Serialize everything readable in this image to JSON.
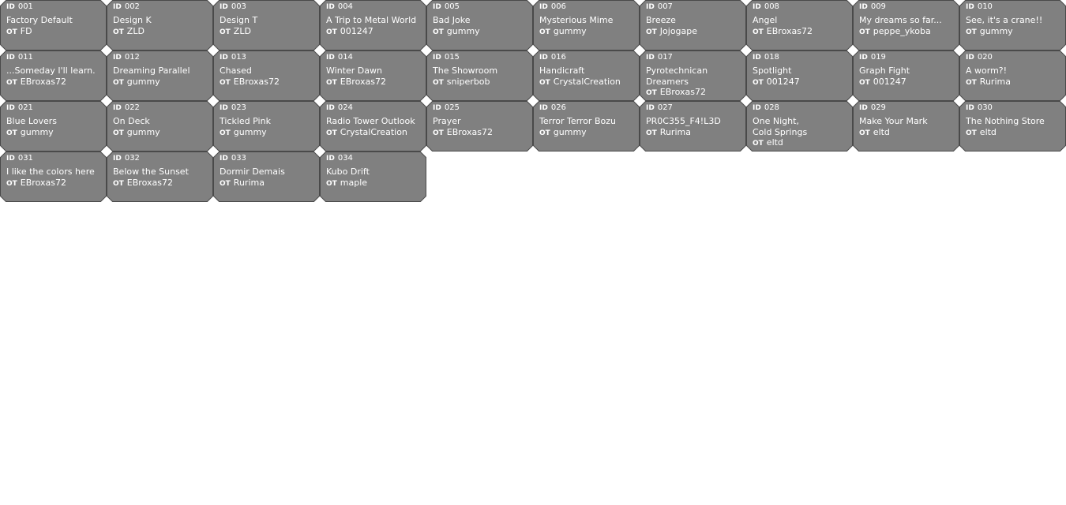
{
  "colors": {
    "tile_fill": "#808080",
    "tile_border": "#4a4a4a",
    "text": "#ffffff",
    "background": "#ffffff"
  },
  "labels": {
    "id_tag": "ID",
    "ot_tag": "OT"
  },
  "tiles": [
    {
      "id": "001",
      "title": "Factory Default",
      "ot": "FD"
    },
    {
      "id": "002",
      "title": "Design K",
      "ot": "ZLD"
    },
    {
      "id": "003",
      "title": "Design T",
      "ot": "ZLD"
    },
    {
      "id": "004",
      "title": "A Trip to Metal World",
      "ot": "001247"
    },
    {
      "id": "005",
      "title": "Bad Joke",
      "ot": "gummy"
    },
    {
      "id": "006",
      "title": "Mysterious Mime",
      "ot": "gummy"
    },
    {
      "id": "007",
      "title": "Breeze",
      "ot": "Jojogape"
    },
    {
      "id": "008",
      "title": "Angel",
      "ot": "EBroxas72"
    },
    {
      "id": "009",
      "title": "My dreams so far...",
      "ot": "peppe_ykoba"
    },
    {
      "id": "010",
      "title": "See, it's a crane!!",
      "ot": "gummy"
    },
    {
      "id": "011",
      "title": "...Someday I'll learn.",
      "ot": "EBroxas72"
    },
    {
      "id": "012",
      "title": "Dreaming Parallel",
      "ot": "gummy"
    },
    {
      "id": "013",
      "title": "Chased",
      "ot": "EBroxas72"
    },
    {
      "id": "014",
      "title": "Winter Dawn",
      "ot": "EBroxas72"
    },
    {
      "id": "015",
      "title": "The Showroom",
      "ot": "sniperbob"
    },
    {
      "id": "016",
      "title": "Handicraft",
      "ot": "CrystalCreation"
    },
    {
      "id": "017",
      "title": "Pyrotechnican\nDreamers",
      "ot": "EBroxas72"
    },
    {
      "id": "018",
      "title": "Spotlight",
      "ot": "001247"
    },
    {
      "id": "019",
      "title": "Graph Fight",
      "ot": "001247"
    },
    {
      "id": "020",
      "title": "A worm?!",
      "ot": "Rurima"
    },
    {
      "id": "021",
      "title": "Blue Lovers",
      "ot": "gummy"
    },
    {
      "id": "022",
      "title": "On Deck",
      "ot": "gummy"
    },
    {
      "id": "023",
      "title": "Tickled Pink",
      "ot": "gummy"
    },
    {
      "id": "024",
      "title": "Radio Tower Outlook",
      "ot": "CrystalCreation"
    },
    {
      "id": "025",
      "title": "Prayer",
      "ot": "EBroxas72"
    },
    {
      "id": "026",
      "title": "Terror Terror Bozu",
      "ot": "gummy"
    },
    {
      "id": "027",
      "title": "PR0C355_F4!L3D",
      "ot": "Rurima"
    },
    {
      "id": "028",
      "title": "One Night,\nCold Springs",
      "ot": "eltd"
    },
    {
      "id": "029",
      "title": "Make Your Mark",
      "ot": "eltd"
    },
    {
      "id": "030",
      "title": "The Nothing Store",
      "ot": "eltd"
    },
    {
      "id": "031",
      "title": "I like the colors here",
      "ot": "EBroxas72"
    },
    {
      "id": "032",
      "title": "Below the Sunset",
      "ot": "EBroxas72"
    },
    {
      "id": "033",
      "title": "Dormir Demais",
      "ot": "Rurima"
    },
    {
      "id": "034",
      "title": "Kubo Drift",
      "ot": "maple"
    }
  ]
}
